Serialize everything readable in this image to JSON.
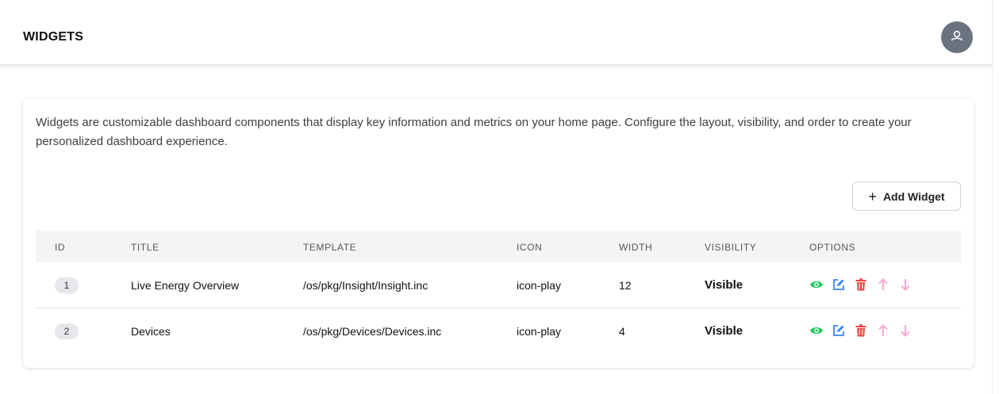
{
  "header": {
    "title": "WIDGETS"
  },
  "intro": {
    "description": "Widgets are customizable dashboard components that display key information and metrics on your home page. Configure the layout, visibility, and order to create your personalized dashboard experience."
  },
  "toolbar": {
    "add_label": "Add Widget",
    "add_icon": "+"
  },
  "table": {
    "columns": [
      "ID",
      "TITLE",
      "TEMPLATE",
      "ICON",
      "WIDTH",
      "VISIBILITY",
      "OPTIONS"
    ],
    "rows": [
      {
        "id": "1",
        "title": "Live Energy Overview",
        "template": "/os/pkg/Insight/Insight.inc",
        "icon": "icon-play",
        "width": "12",
        "visibility": "Visible"
      },
      {
        "id": "2",
        "title": "Devices",
        "template": "/os/pkg/Devices/Devices.inc",
        "icon": "icon-play",
        "width": "4",
        "visibility": "Visible"
      }
    ]
  },
  "option_icons": [
    "eye-icon",
    "edit-icon",
    "trash-icon",
    "arrow-up-icon",
    "arrow-down-icon"
  ],
  "colors": {
    "eye": "#22c55e",
    "edit": "#3b82f6",
    "trash": "#ef4444",
    "arrow_up": "#f9a8d4",
    "arrow_down": "#f9a8d4",
    "avatar": "#6b7280"
  }
}
